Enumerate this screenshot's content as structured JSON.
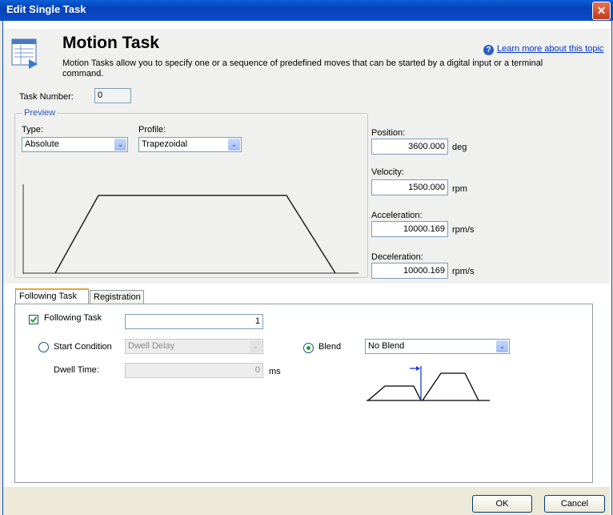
{
  "window": {
    "title": "Edit Single Task",
    "close_label": "✕"
  },
  "header": {
    "title": "Motion Task",
    "description": "Motion Tasks allow you to specify one or a sequence of predefined moves that can be started by a digital input or a terminal command.",
    "help_link": "Learn more about this topic",
    "help_icon": "?"
  },
  "task_number": {
    "label": "Task Number:",
    "value": "0"
  },
  "preview": {
    "legend": "Preview",
    "type_label": "Type:",
    "type_value": "Absolute",
    "profile_label": "Profile:",
    "profile_value": "Trapezoidal"
  },
  "params": {
    "position_label": "Position:",
    "position_value": "3600.000",
    "position_unit": "deg",
    "velocity_label": "Velocity:",
    "velocity_value": "1500.000",
    "velocity_unit": "rpm",
    "acceleration_label": "Acceleration:",
    "acceleration_value": "10000.169",
    "acceleration_unit": "rpm/s",
    "deceleration_label": "Deceleration:",
    "deceleration_value": "10000.169",
    "deceleration_unit": "rpm/s"
  },
  "tabs": [
    {
      "label": "Following Task"
    },
    {
      "label": "Registration"
    }
  ],
  "following": {
    "checkbox_label": "Following Task",
    "checked": true,
    "task_value": "1",
    "start_condition_label": "Start Condition",
    "start_condition_value": "Dwell Delay",
    "blend_label": "Blend",
    "blend_value": "No Blend",
    "dwell_label": "Dwell Time:",
    "dwell_value": "0",
    "dwell_unit": "ms"
  },
  "buttons": {
    "ok": "OK",
    "cancel": "Cancel"
  },
  "combo_arrow": "⌄",
  "colors": {
    "title_bar": "#0a4cc8",
    "link": "#0033cc",
    "legend": "#2a5ab5"
  }
}
